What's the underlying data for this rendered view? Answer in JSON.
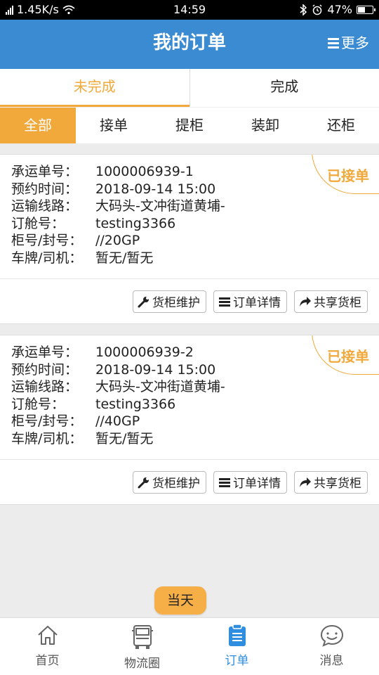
{
  "statusbar": {
    "speed": "1.45K/s",
    "time": "14:59",
    "battery": "47%"
  },
  "header": {
    "title": "我的订单",
    "more": "更多"
  },
  "status_tabs": [
    {
      "label": "未完成"
    },
    {
      "label": "完成"
    }
  ],
  "filter_tabs": [
    {
      "label": "全部"
    },
    {
      "label": "接单"
    },
    {
      "label": "提柜"
    },
    {
      "label": "装卸"
    },
    {
      "label": "还柜"
    }
  ],
  "labels": {
    "waybill_no": "承运单号：",
    "booking_time": "预约时间：",
    "route": "运输线路：",
    "booking_no": "订舱号：",
    "container_seal": "柜号/封号：",
    "plate_driver": "车牌/司机："
  },
  "orders": [
    {
      "badge": "已接单",
      "waybill_no": "1000006939-1",
      "booking_time": "2018-09-14 15:00",
      "route": "大码头-文冲街道黄埔-",
      "booking_no": "testing3366",
      "container_seal": "//20GP",
      "plate_driver": "暂无/暂无"
    },
    {
      "badge": "已接单",
      "waybill_no": "1000006939-2",
      "booking_time": "2018-09-14 15:00",
      "route": "大码头-文冲街道黄埔-",
      "booking_no": "testing3366",
      "container_seal": "//40GP",
      "plate_driver": "暂无/暂无"
    }
  ],
  "actions": {
    "maintain": "货柜维护",
    "detail": "订单详情",
    "share": "共享货柜"
  },
  "today": "当天",
  "nav": [
    {
      "label": "首页"
    },
    {
      "label": "物流圈"
    },
    {
      "label": "订单"
    },
    {
      "label": "消息"
    }
  ],
  "colors": {
    "header_blue": "#3a8bd2",
    "accent_orange": "#f0a93a",
    "nav_active": "#2f8ee0"
  }
}
